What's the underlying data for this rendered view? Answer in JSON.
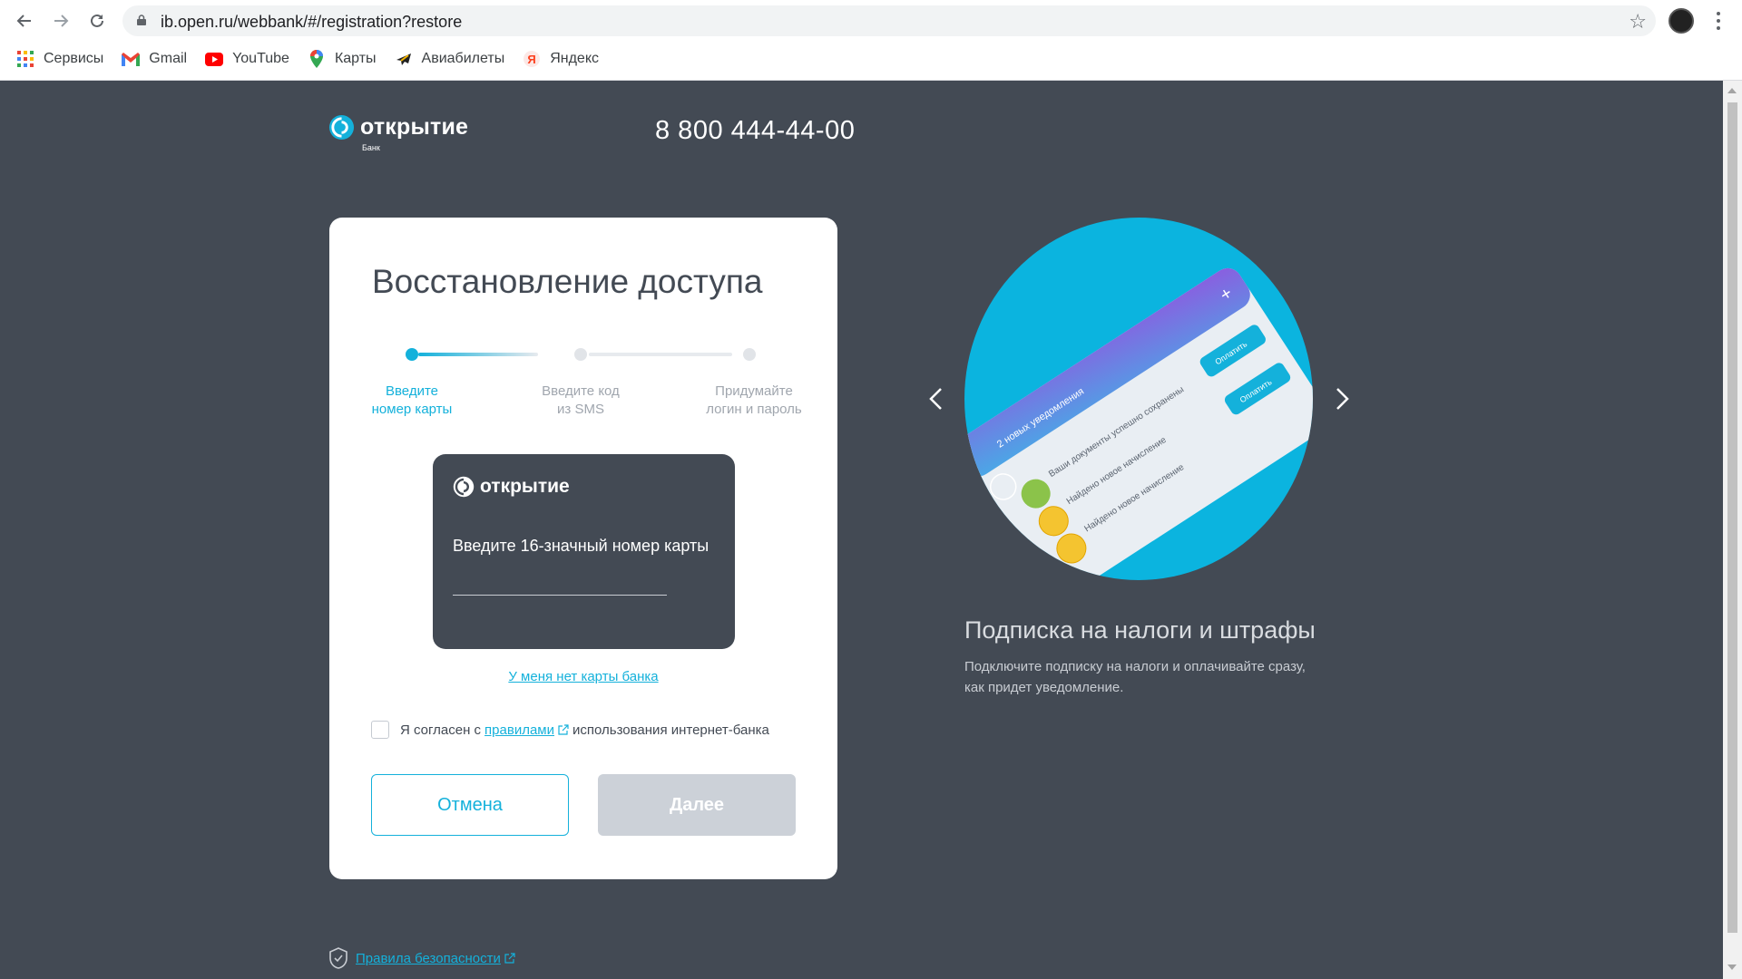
{
  "browser": {
    "url": "ib.open.ru/webbank/#/registration?restore",
    "bookmarks": [
      {
        "label": "Сервисы",
        "icon": "apps-grid-icon"
      },
      {
        "label": "Gmail",
        "icon": "gmail-icon"
      },
      {
        "label": "YouTube",
        "icon": "youtube-icon"
      },
      {
        "label": "Карты",
        "icon": "maps-pin-icon"
      },
      {
        "label": "Авиабилеты",
        "icon": "airplane-icon"
      },
      {
        "label": "Яндекс",
        "icon": "yandex-icon"
      }
    ]
  },
  "header": {
    "logo_text": "открытие",
    "logo_sub": "Банк",
    "phone": "8 800 444-44-00"
  },
  "form": {
    "title": "Восстановление доступа",
    "steps": [
      {
        "label_line1": "Введите",
        "label_line2": "номер карты",
        "state": "active"
      },
      {
        "label_line1": "Введите код",
        "label_line2": "из SMS",
        "state": "pending"
      },
      {
        "label_line1": "Придумайте",
        "label_line2": "логин и пароль",
        "state": "pending"
      }
    ],
    "card": {
      "logo_text": "открытие",
      "prompt": "Введите 16-значный номер карты",
      "card_number_value": ""
    },
    "no_card_link": "У меня нет карты банка",
    "agree": {
      "prefix": "Я согласен с",
      "link": "правилами",
      "suffix": "использования интернет-банка",
      "checked": false
    },
    "cancel_label": "Отмена",
    "next_label": "Далее"
  },
  "security_link": "Правила безопасности",
  "promo": {
    "title": "Подписка на налоги и штрафы",
    "text": "Подключите подписку на налоги и оплачивайте сразу, как придет уведомление.",
    "illustration": {
      "notifications_header": "2 новых уведомления",
      "rows": [
        "Ваши документы успешно сохранены",
        "Найдено новое начисление",
        "Найдено новое начисление"
      ],
      "pay_label": "Оплатить"
    }
  },
  "colors": {
    "page_bg": "#434a54",
    "accent": "#14b1db",
    "button_disabled": "#ccd1d8"
  }
}
